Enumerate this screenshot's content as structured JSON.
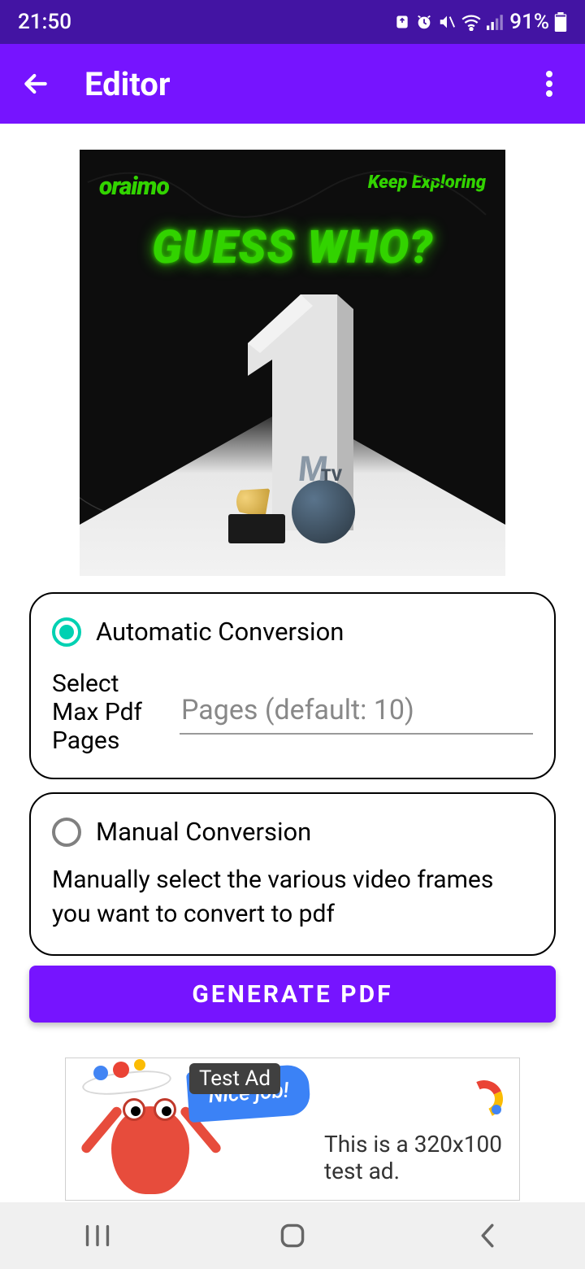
{
  "status": {
    "time": "21:50",
    "battery": "91%"
  },
  "app_bar": {
    "title": "Editor"
  },
  "hero": {
    "brand": "oraimo",
    "tagline": "Keep Exploring",
    "headline": "GUESS WHO?"
  },
  "auto_card": {
    "radio_label": "Automatic Conversion",
    "pages_label": "Select Max Pdf Pages",
    "pages_placeholder": "Pages (default: 10)",
    "selected": true
  },
  "manual_card": {
    "radio_label": "Manual Conversion",
    "description": "Manually select the various video frames you want to convert to pdf",
    "selected": false
  },
  "generate_button": "GENERATE PDF",
  "ad": {
    "tag": "Test Ad",
    "flag": "Nice job!",
    "text": "This is a 320x100 test ad."
  }
}
